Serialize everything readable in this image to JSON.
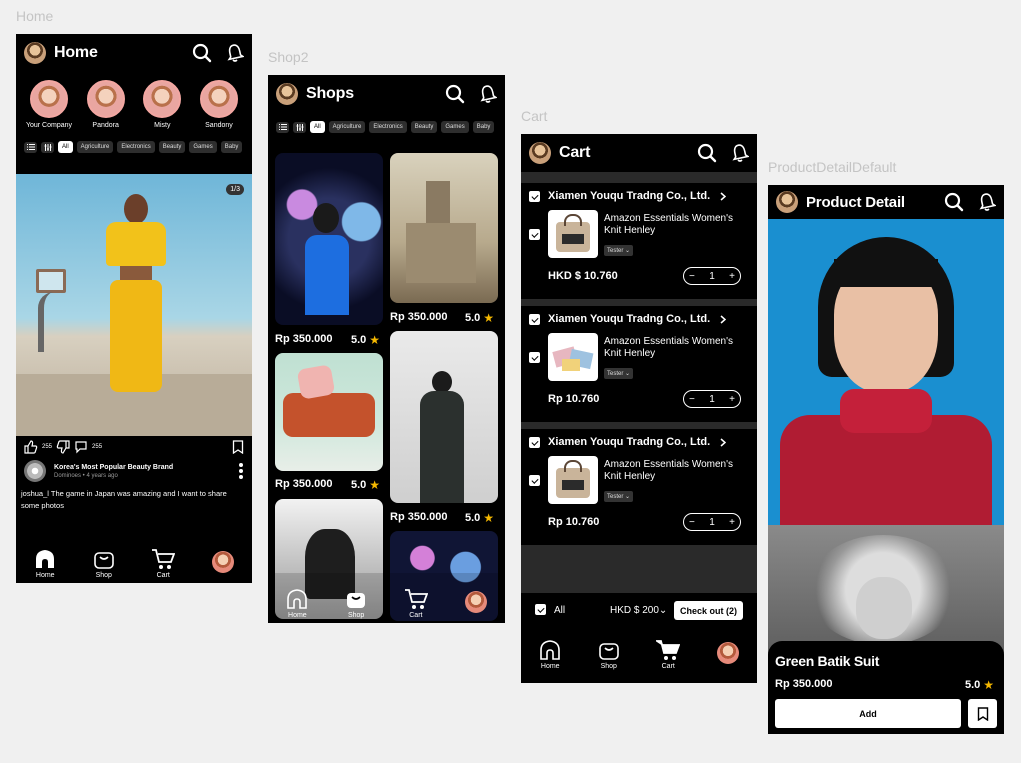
{
  "labels": {
    "home": "Home",
    "shop2": "Shop2",
    "cart": "Cart",
    "detail": "ProductDetailDefault"
  },
  "home": {
    "title": "Home",
    "stories": [
      "Your Company",
      "Pandora",
      "Misty",
      "Sandony"
    ],
    "chips": [
      "All",
      "Agriculture",
      "Electronics",
      "Beauty",
      "Games",
      "Baby"
    ],
    "pager": "1/3",
    "likes": "255",
    "comments": "255",
    "post_title": "Korea's Most Popular Beauty Brand",
    "post_meta": "Dominoes • 4 years ago",
    "post_text": "joshua_l The game in Japan was amazing and I want to share some photos",
    "nav": [
      "Home",
      "Shop",
      "Cart"
    ]
  },
  "shop": {
    "title": "Shops",
    "chips": [
      "All",
      "Agriculture",
      "Electronics",
      "Beauty",
      "Games",
      "Baby"
    ],
    "products": [
      {
        "price": "Rp 350.000",
        "rating": "5.0"
      },
      {
        "price": "Rp 350.000",
        "rating": "5.0"
      },
      {
        "price": "Rp 350.000",
        "rating": "5.0"
      },
      {
        "price": "Rp 350.000",
        "rating": "5.0"
      }
    ],
    "nav": [
      "Home",
      "Shop",
      "Cart"
    ]
  },
  "cart": {
    "title": "Cart",
    "items": [
      {
        "shop": "Xiamen Youqu Tradng Co., Ltd.",
        "name": "Amazon Essentials Women's Knit Henley",
        "variant": "Tester",
        "price": "HKD $ 10.760",
        "qty": "1"
      },
      {
        "shop": "Xiamen Youqu Tradng Co., Ltd.",
        "name": "Amazon Essentials Women's Knit Henley",
        "variant": "Tester",
        "price": "Rp 10.760",
        "qty": "1"
      },
      {
        "shop": "Xiamen Youqu Tradng Co., Ltd.",
        "name": "Amazon Essentials Women's Knit Henley",
        "variant": "Tester",
        "price": "Rp 10.760",
        "qty": "1"
      }
    ],
    "all_label": "All",
    "total": "HKD $ 200",
    "checkout": "Check out (2)",
    "nav": [
      "Home",
      "Shop",
      "Cart"
    ]
  },
  "detail": {
    "title": "Product Detail",
    "product_name": "Green Batik Suit",
    "price": "Rp 350.000",
    "rating": "5.0",
    "add": "Add"
  },
  "colors": {
    "accent": "#f5b800",
    "bg": "#000000",
    "canvas": "#f0f0f0"
  }
}
